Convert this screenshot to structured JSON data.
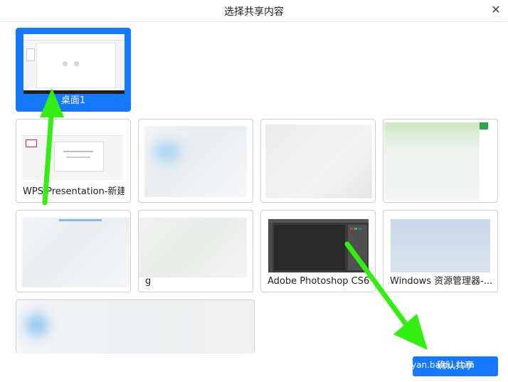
{
  "dialog": {
    "title": "选择共享内容",
    "close_icon": "close-icon"
  },
  "screens": [
    {
      "label": "桌面1",
      "selected": true
    }
  ],
  "windows": [
    {
      "label": "WPS Presentation-新建..."
    },
    {
      "label": ""
    },
    {
      "label": ""
    },
    {
      "label": ""
    },
    {
      "label": ""
    },
    {
      "label": "g"
    },
    {
      "label": "Adobe Photoshop CS6..."
    },
    {
      "label": "Windows 资源管理器-..."
    },
    {
      "label": ""
    }
  ],
  "footer": {
    "confirm_label": "确认共享",
    "watermark": "yan.baidu.com"
  },
  "colors": {
    "accent": "#1677ff",
    "annotation_arrow": "#33ee11"
  }
}
